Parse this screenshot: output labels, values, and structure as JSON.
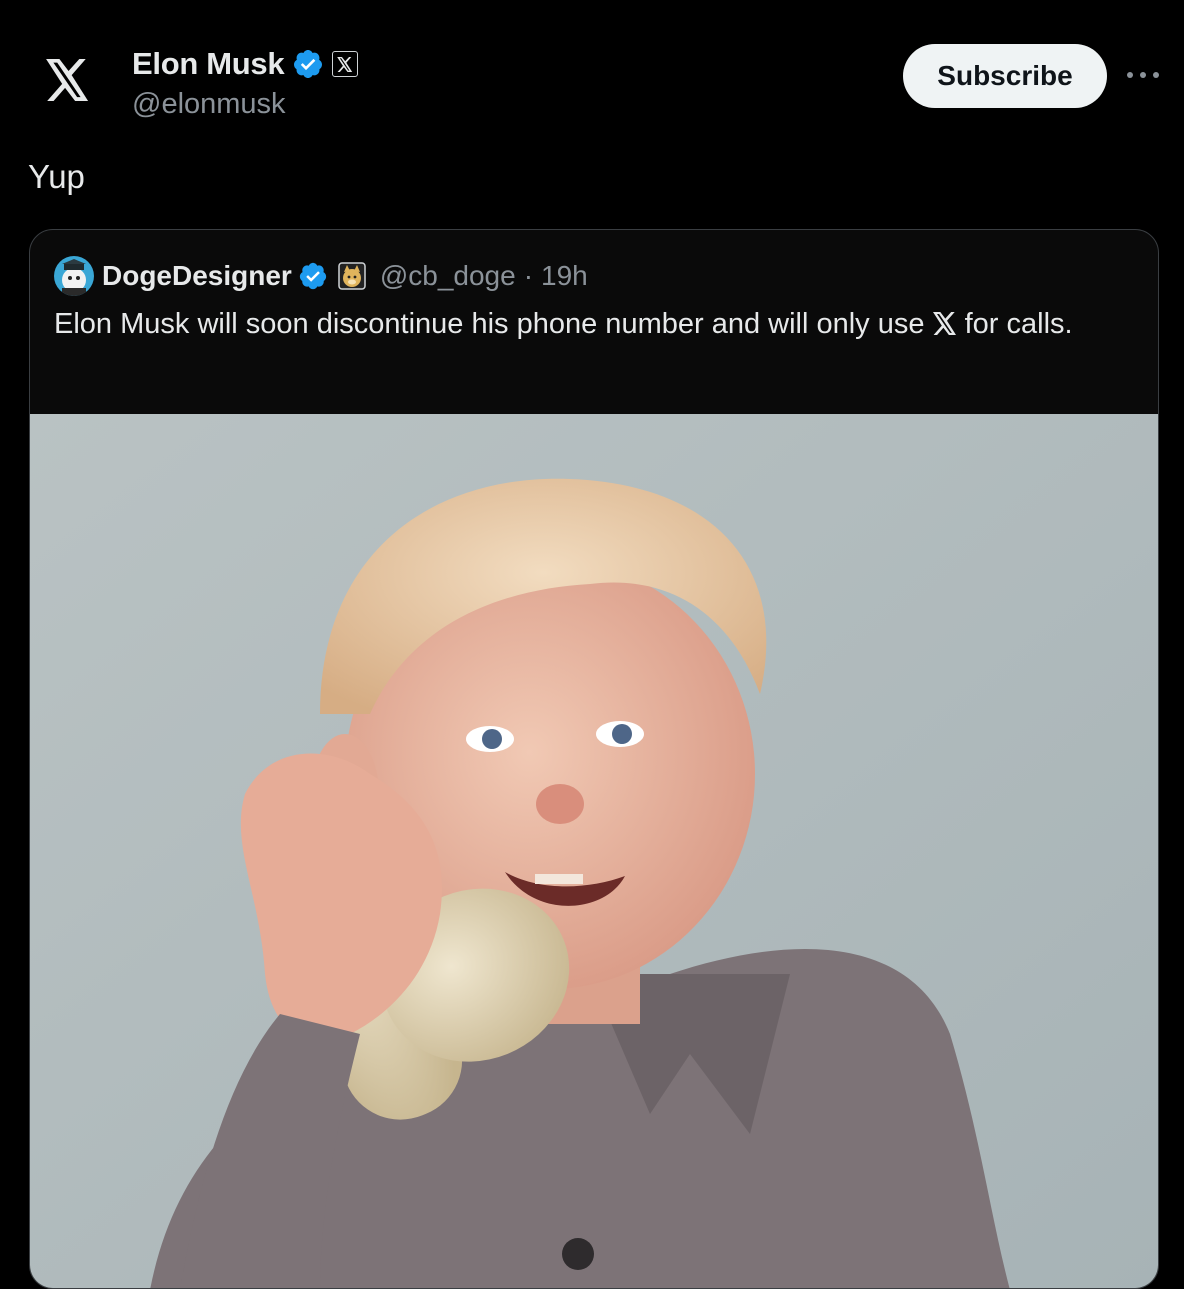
{
  "tweet": {
    "author": {
      "name": "Elon Musk",
      "handle": "@elonmusk",
      "avatar_icon": "x-logo-icon",
      "verified_icon": "verified-badge-icon",
      "affiliate_icon": "x-affiliate-badge-icon"
    },
    "subscribe_label": "Subscribe",
    "more_icon": "more-horizontal-icon",
    "text": "Yup"
  },
  "quoted": {
    "author": {
      "name": "DogeDesigner",
      "handle": "@cb_doge",
      "separator": "·",
      "time": "19h",
      "verified_icon": "verified-badge-icon",
      "affiliate_icon": "doge-affiliate-badge-icon"
    },
    "text_before": "Elon Musk will soon discontinue his phone number and will only use ",
    "text_after": " for calls.",
    "inline_icon": "x-logo-icon",
    "image": "photo-child-holding-toy-phone-receiver"
  },
  "colors": {
    "background": "#000000",
    "text": "#e7e9ea",
    "secondary": "#8b9299",
    "verified": "#1d9bf0",
    "button": "#eff3f4"
  }
}
